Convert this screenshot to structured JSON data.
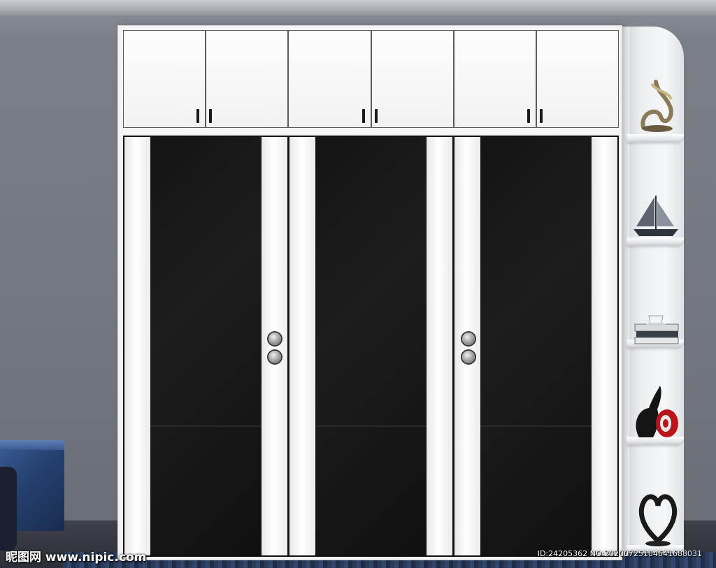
{
  "scene": {
    "subject": "wardrobe",
    "top_cabinet_doors": 6,
    "sliding_door_panels": 3,
    "side_shelves": 5,
    "colors": {
      "wall": "#737880",
      "wardrobe_white": "#f3f3f3",
      "door_black": "#151515",
      "stool_blue": "#24406f",
      "rug_blue": "#2a3e63"
    },
    "shelf_items": [
      "sculpture-icon",
      "sailboat-icon",
      "books-cup-icon",
      "elephant-vase-icon",
      "heart-sculpture-icon"
    ]
  },
  "watermark": {
    "brand": "昵图网 www.nipic.com",
    "id": "ID:24205362 NO:20200725104641688031"
  }
}
